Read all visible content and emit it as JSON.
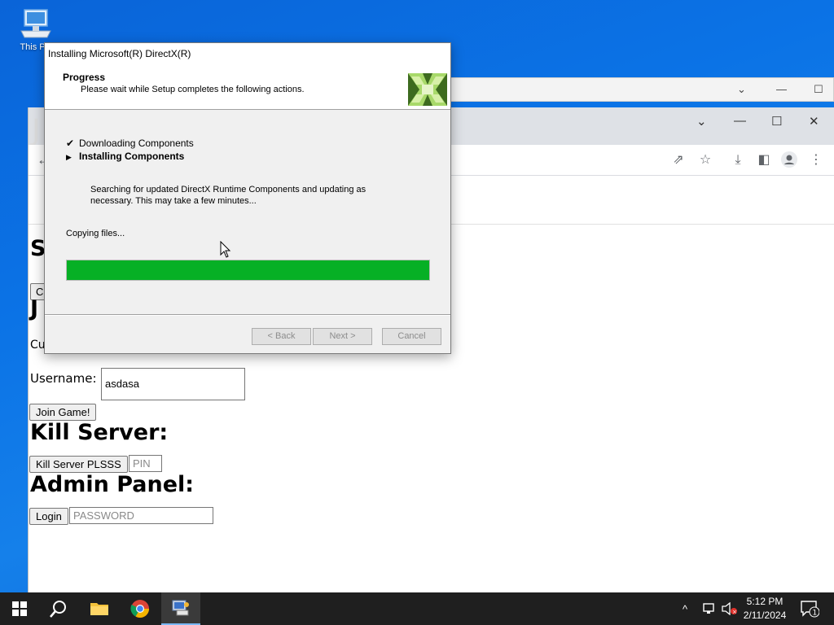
{
  "desktop": {
    "icon_label": "This PC"
  },
  "dialog": {
    "title": "Installing Microsoft(R) DirectX(R)",
    "header_title": "Progress",
    "header_subtitle": "Please wait while Setup completes the following actions.",
    "steps": [
      {
        "label": "Downloading Components",
        "status": "done"
      },
      {
        "label": "Installing Components",
        "status": "current"
      }
    ],
    "description": "Searching for updated DirectX Runtime Components and updating as necessary. This may take a few minutes...",
    "status_text": "Copying files...",
    "progress_fraction": 1.0,
    "buttons": {
      "back": "< Back",
      "next": "Next >",
      "cancel": "Cancel"
    }
  },
  "browser": {
    "page": {
      "heading_s": "S",
      "button_c": "Cl",
      "heading_j": "J",
      "text_cu": "Cu",
      "username_label": "Username:",
      "username_value": "asdasa",
      "join_button": "Join Game!",
      "kill_heading": "Kill Server:",
      "kill_button": "Kill Server PLSSS",
      "pin_placeholder": "PIN",
      "admin_heading": "Admin Panel:",
      "login_button": "Login",
      "password_placeholder": "PASSWORD"
    }
  },
  "taskbar": {
    "time": "5:12 PM",
    "date": "2/11/2024",
    "notification_count": "1"
  },
  "colors": {
    "progress": "#06b025",
    "taskbar": "#1f1f1f"
  }
}
